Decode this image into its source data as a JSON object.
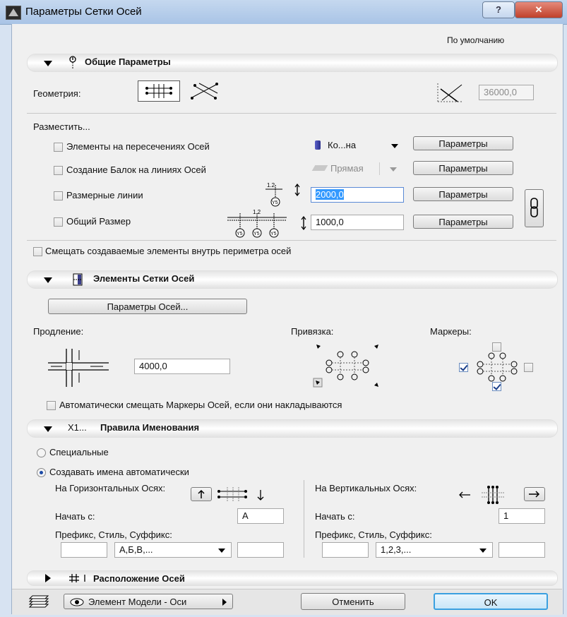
{
  "window": {
    "title": "Параметры Сетки Осей",
    "help": "?",
    "close": "✕"
  },
  "default_label": "По умолчанию",
  "general": {
    "title": "Общие Параметры",
    "geometry_label": "Геометрия:",
    "angle_value": "36000,0",
    "place_label": "Разместить...",
    "rows": [
      {
        "label": "Элементы на пересечениях Осей",
        "dropdown": "Ко...на",
        "button": "Параметры"
      },
      {
        "label": "Создание Балок на линиях Осей",
        "dropdown": "Прямая",
        "button": "Параметры"
      },
      {
        "label": "Размерные линии",
        "value": "2000,0",
        "button": "Параметры"
      },
      {
        "label": "Общий Размер",
        "value": "1000,0",
        "button": "Параметры"
      }
    ],
    "offset_label": "Смещать создаваемые элементы внутрь периметра осей",
    "dim_tag": "1.2",
    "marker_tag": "Y5"
  },
  "grid_elements": {
    "title": "Элементы Сетки Осей",
    "axes_params_button": "Параметры Осей...",
    "extension_label": "Продление:",
    "extension_value": "4000,0",
    "snap_label": "Привязка:",
    "markers_label": "Маркеры:",
    "auto_offset_label": "Автоматически смещать Маркеры Осей, если они накладываются"
  },
  "naming": {
    "prefix_icon": "X1...",
    "title": "Правила Именования",
    "special_label": "Специальные",
    "auto_label": "Создавать имена автоматически",
    "horizontal": {
      "label": "На Горизонтальных Осях:",
      "start_label": "Начать с:",
      "start_value": "А",
      "pss_label": "Префикс, Стиль, Суффикс:",
      "style": "А,Б,В,..."
    },
    "vertical": {
      "label": "На Вертикальных Осях:",
      "start_label": "Начать с:",
      "start_value": "1",
      "pss_label": "Префикс, Стиль, Суффикс:",
      "style": "1,2,3,..."
    }
  },
  "layout_section": {
    "title": "Расположение Осей"
  },
  "footer": {
    "model_element": "Элемент Модели - Оси",
    "cancel": "Отменить",
    "ok": "OK"
  }
}
